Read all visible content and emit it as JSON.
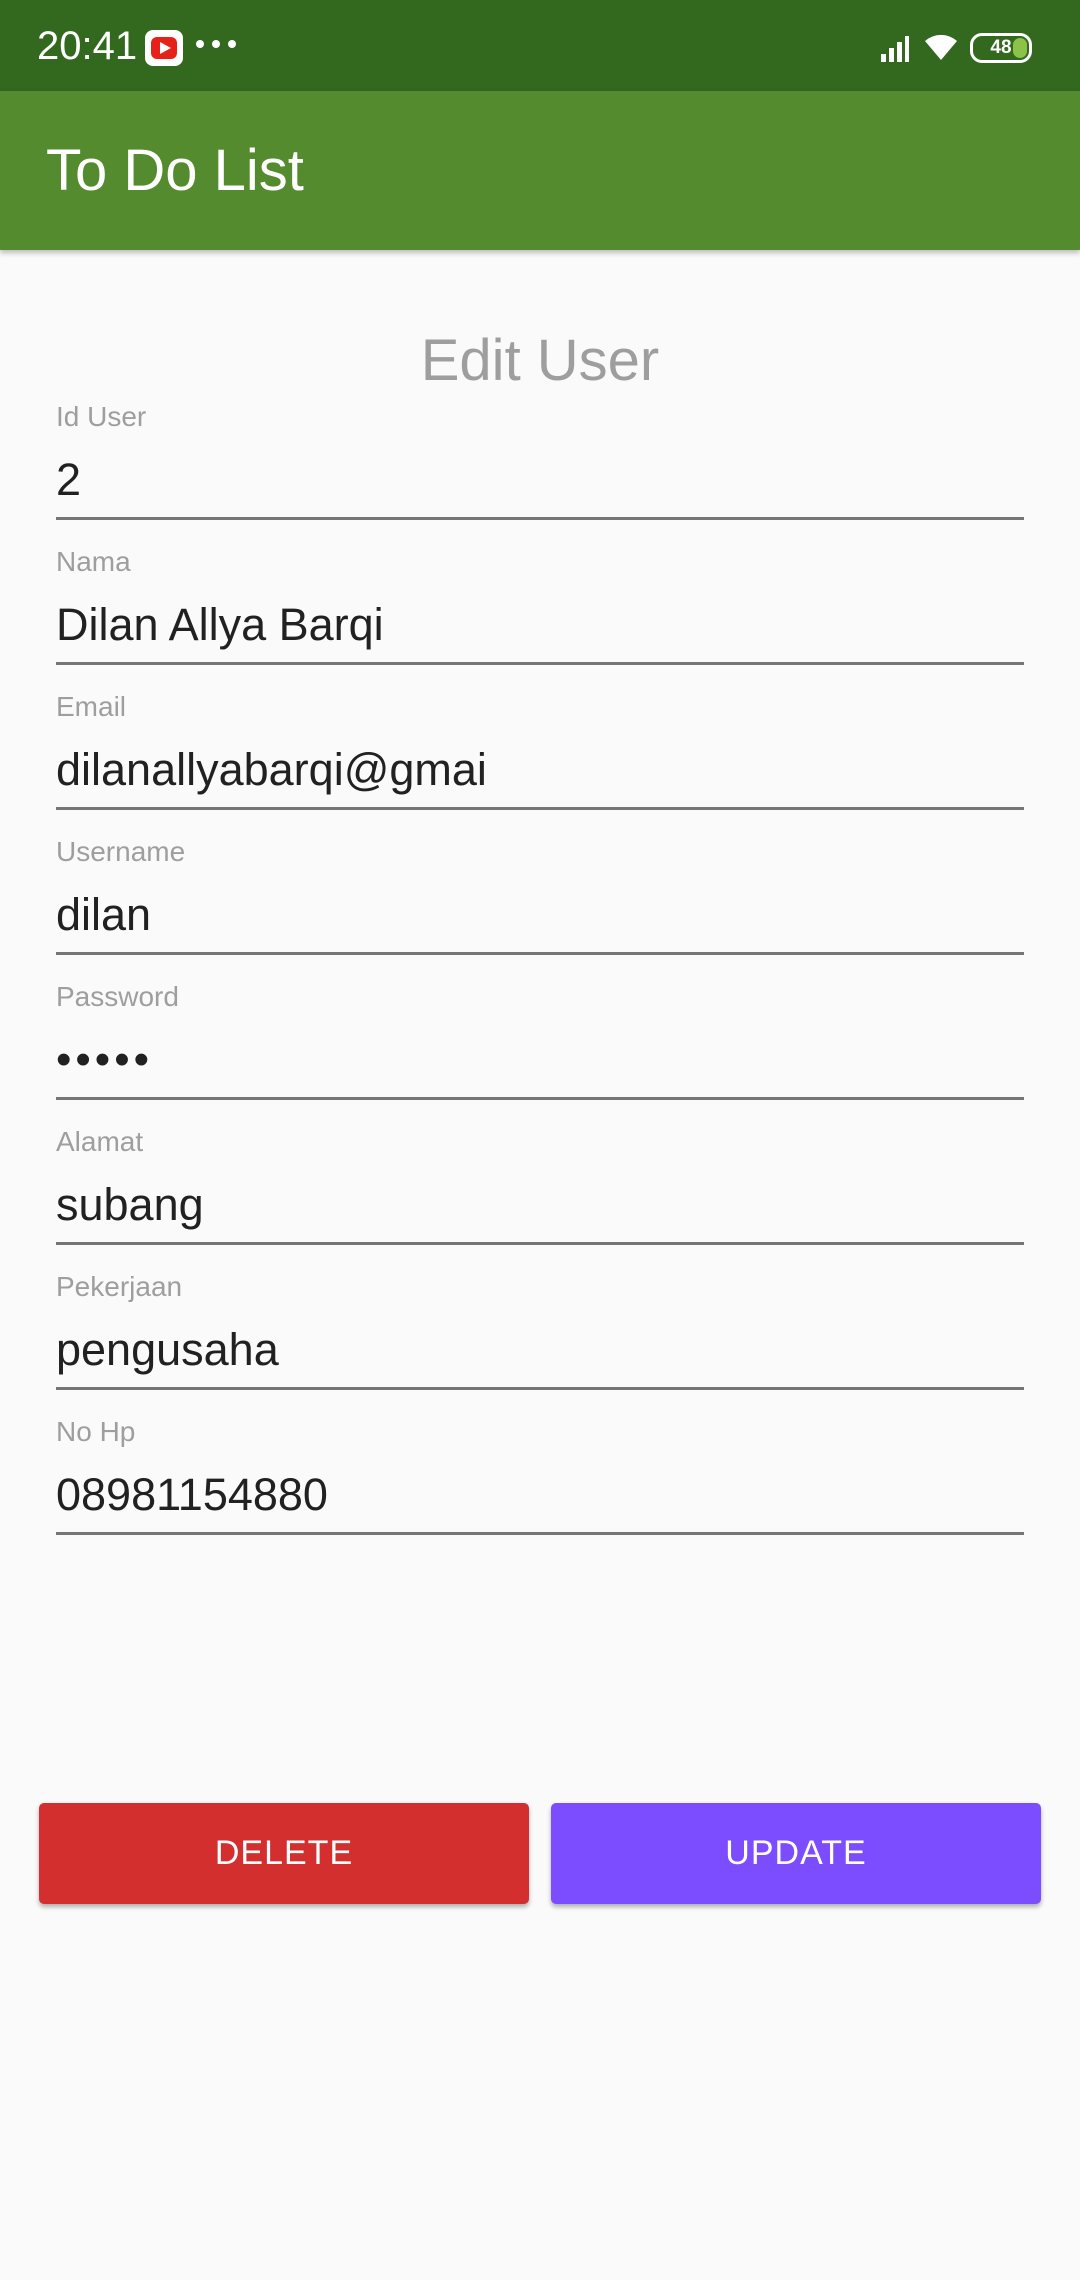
{
  "status_bar": {
    "time": "20:41",
    "notification_icon": "youtube-icon",
    "more_icon": "more-dots-icon",
    "signal_icon": "signal-icon",
    "wifi_icon": "wifi-icon",
    "battery_level": "48",
    "battery_color": "#8bc34a"
  },
  "app_bar": {
    "title": "To Do List",
    "color": "#558b2f"
  },
  "form": {
    "title": "Edit User",
    "fields": [
      {
        "label": "Id User",
        "value": "2"
      },
      {
        "label": "Nama",
        "value": "Dilan Allya Barqi"
      },
      {
        "label": "Email",
        "value": "dilanallyabarqi@gmai"
      },
      {
        "label": "Username",
        "value": "dilan"
      },
      {
        "label": "Password",
        "value": "•••••"
      },
      {
        "label": "Alamat",
        "value": "subang"
      },
      {
        "label": "Pekerjaan",
        "value": "pengusaha"
      },
      {
        "label": "No Hp",
        "value": "08981154880"
      }
    ]
  },
  "actions": {
    "delete_label": "DELETE",
    "update_label": "UPDATE",
    "delete_color": "#d32f2f",
    "update_color": "#7c4dff"
  }
}
